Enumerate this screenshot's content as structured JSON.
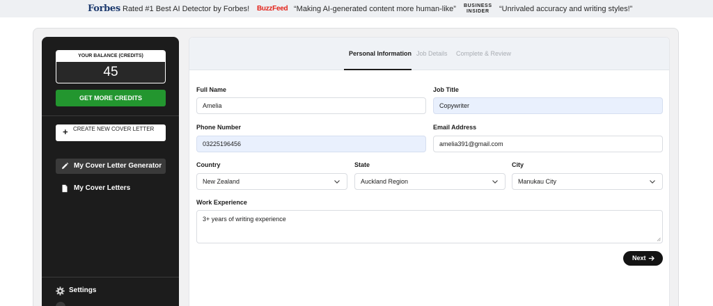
{
  "banner": {
    "forbes_logo": "Forbes",
    "forbes_text": "Rated #1 Best AI Detector by Forbes!",
    "buzzfeed_logo": "BuzzFeed",
    "buzzfeed_text": "“Making AI-generated content more human-like”",
    "bi_logo_line1": "BUSINESS",
    "bi_logo_line2": "INSIDER",
    "bi_text": "“Unrivaled accuracy and writing styles!”"
  },
  "sidebar": {
    "balance_label": "YOUR BALANCE (CREDITS)",
    "balance_value": "45",
    "get_credits_label": "GET MORE CREDITS",
    "create_label": "CREATE NEW COVER LETTER",
    "nav": [
      {
        "label": "My Cover Letter Generator",
        "icon": "pencil-icon",
        "active": true
      },
      {
        "label": "My Cover Letters",
        "icon": "document-icon",
        "active": false
      }
    ],
    "settings_label": "Settings"
  },
  "steps": [
    {
      "label": "Personal Information",
      "active": true
    },
    {
      "label": "Job Details",
      "active": false
    },
    {
      "label": "Complete & Review",
      "active": false
    }
  ],
  "form": {
    "full_name": {
      "label": "Full Name",
      "value": "Amelia"
    },
    "job_title": {
      "label": "Job Title",
      "value": "Copywriter"
    },
    "phone": {
      "label": "Phone Number",
      "value": "03225196456"
    },
    "email": {
      "label": "Email Address",
      "value": "amelia391@gmail.com"
    },
    "country": {
      "label": "Country",
      "value": "New Zealand"
    },
    "state": {
      "label": "State",
      "value": "Auckland Region"
    },
    "city": {
      "label": "City",
      "value": "Manukau City"
    },
    "experience": {
      "label": "Work Experience",
      "value": "3+ years of writing experience"
    },
    "next_label": "Next"
  },
  "colors": {
    "sidebar_bg": "#1c1c1c",
    "credits_green": "#23962f",
    "filled_field_bg": "#e9f0fd",
    "buzzfeed_red": "#e32219",
    "forbes_blue": "#1d3a6e"
  }
}
